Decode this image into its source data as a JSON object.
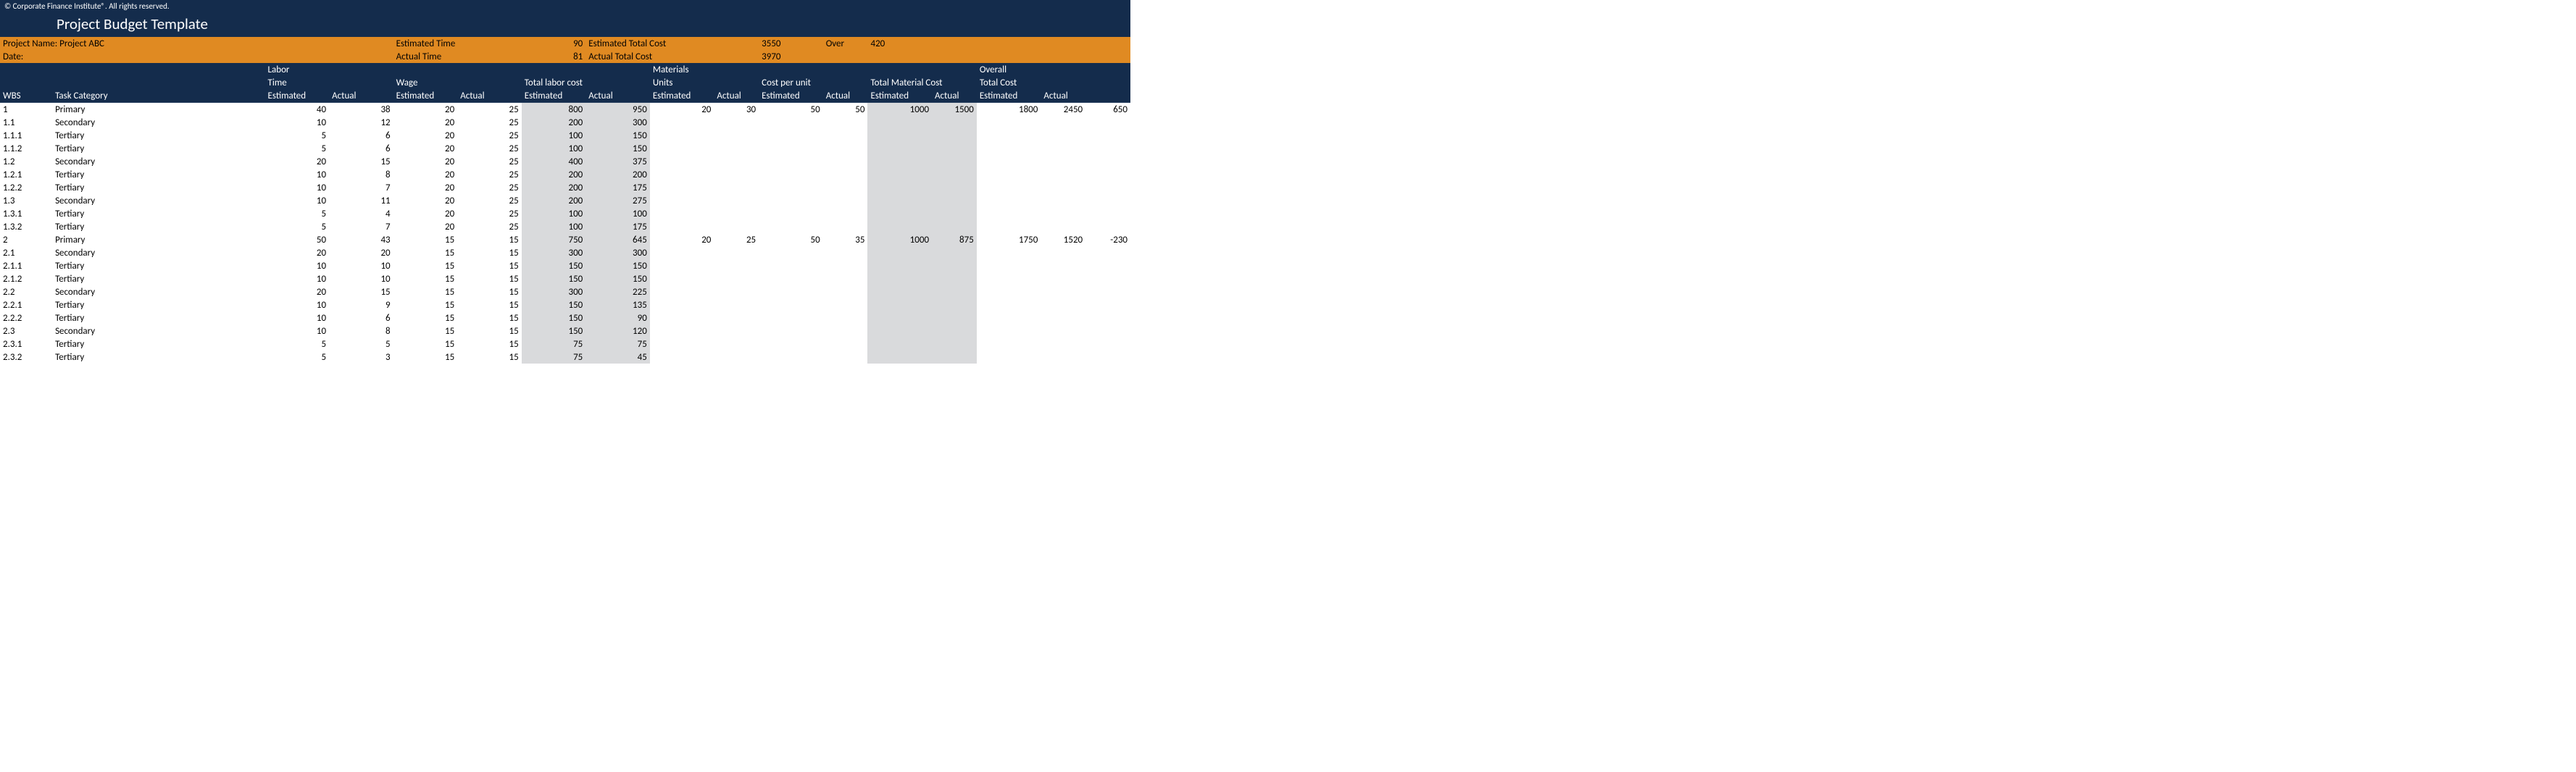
{
  "copyright": "© Corporate Finance Institute®. All rights reserved.",
  "title": "Project Budget Template",
  "summary": {
    "project_name_label": "Project Name: Project ABC",
    "date_label": "Date:",
    "est_time_label": "Estimated Time",
    "est_time": "90",
    "est_total_cost_label": "Estimated Total Cost",
    "est_total_cost": "3550",
    "over_label": "Over",
    "over": "420",
    "act_time_label": "Actual Time",
    "act_time": "81",
    "act_total_cost_label": "Actual Total Cost",
    "act_total_cost": "3970"
  },
  "hdr": {
    "wbs": "WBS",
    "task": "Task Category",
    "labor": "Labor",
    "time": "Time",
    "wage": "Wage",
    "tlc": "Total labor cost",
    "materials": "Materials",
    "units": "Units",
    "cpu": "Cost per unit",
    "tmc": "Total Material Cost",
    "overall": "Overall",
    "tc": "Total Cost",
    "est": "Estimated",
    "act": "Actual"
  },
  "rows": [
    {
      "wbs": "1",
      "task": "Primary",
      "te": "40",
      "ta": "38",
      "we": "20",
      "wa": "25",
      "lce": "800",
      "lca": "950",
      "ue": "20",
      "ua": "30",
      "cpe": "50",
      "cpa": "50",
      "mce": "1000",
      "mca": "1500",
      "tce": "1800",
      "tca": "2450",
      "var": "650"
    },
    {
      "wbs": "1.1",
      "task": "Secondary",
      "te": "10",
      "ta": "12",
      "we": "20",
      "wa": "25",
      "lce": "200",
      "lca": "300"
    },
    {
      "wbs": "1.1.1",
      "task": "Tertiary",
      "te": "5",
      "ta": "6",
      "we": "20",
      "wa": "25",
      "lce": "100",
      "lca": "150"
    },
    {
      "wbs": "1.1.2",
      "task": "Tertiary",
      "te": "5",
      "ta": "6",
      "we": "20",
      "wa": "25",
      "lce": "100",
      "lca": "150"
    },
    {
      "wbs": "1.2",
      "task": "Secondary",
      "te": "20",
      "ta": "15",
      "we": "20",
      "wa": "25",
      "lce": "400",
      "lca": "375"
    },
    {
      "wbs": "1.2.1",
      "task": "Tertiary",
      "te": "10",
      "ta": "8",
      "we": "20",
      "wa": "25",
      "lce": "200",
      "lca": "200"
    },
    {
      "wbs": "1.2.2",
      "task": "Tertiary",
      "te": "10",
      "ta": "7",
      "we": "20",
      "wa": "25",
      "lce": "200",
      "lca": "175"
    },
    {
      "wbs": "1.3",
      "task": "Secondary",
      "te": "10",
      "ta": "11",
      "we": "20",
      "wa": "25",
      "lce": "200",
      "lca": "275"
    },
    {
      "wbs": "1.3.1",
      "task": "Tertiary",
      "te": "5",
      "ta": "4",
      "we": "20",
      "wa": "25",
      "lce": "100",
      "lca": "100"
    },
    {
      "wbs": "1.3.2",
      "task": "Tertiary",
      "te": "5",
      "ta": "7",
      "we": "20",
      "wa": "25",
      "lce": "100",
      "lca": "175"
    },
    {
      "wbs": "2",
      "task": "Primary",
      "te": "50",
      "ta": "43",
      "we": "15",
      "wa": "15",
      "lce": "750",
      "lca": "645",
      "ue": "20",
      "ua": "25",
      "cpe": "50",
      "cpa": "35",
      "mce": "1000",
      "mca": "875",
      "tce": "1750",
      "tca": "1520",
      "var": "-230"
    },
    {
      "wbs": "2.1",
      "task": "Secondary",
      "te": "20",
      "ta": "20",
      "we": "15",
      "wa": "15",
      "lce": "300",
      "lca": "300"
    },
    {
      "wbs": "2.1.1",
      "task": "Tertiary",
      "te": "10",
      "ta": "10",
      "we": "15",
      "wa": "15",
      "lce": "150",
      "lca": "150"
    },
    {
      "wbs": "2.1.2",
      "task": "Tertiary",
      "te": "10",
      "ta": "10",
      "we": "15",
      "wa": "15",
      "lce": "150",
      "lca": "150"
    },
    {
      "wbs": "2.2",
      "task": "Secondary",
      "te": "20",
      "ta": "15",
      "we": "15",
      "wa": "15",
      "lce": "300",
      "lca": "225"
    },
    {
      "wbs": "2.2.1",
      "task": "Tertiary",
      "te": "10",
      "ta": "9",
      "we": "15",
      "wa": "15",
      "lce": "150",
      "lca": "135"
    },
    {
      "wbs": "2.2.2",
      "task": "Tertiary",
      "te": "10",
      "ta": "6",
      "we": "15",
      "wa": "15",
      "lce": "150",
      "lca": "90"
    },
    {
      "wbs": "2.3",
      "task": "Secondary",
      "te": "10",
      "ta": "8",
      "we": "15",
      "wa": "15",
      "lce": "150",
      "lca": "120"
    },
    {
      "wbs": "2.3.1",
      "task": "Tertiary",
      "te": "5",
      "ta": "5",
      "we": "15",
      "wa": "15",
      "lce": "75",
      "lca": "75"
    },
    {
      "wbs": "2.3.2",
      "task": "Tertiary",
      "te": "5",
      "ta": "3",
      "we": "15",
      "wa": "15",
      "lce": "75",
      "lca": "45"
    }
  ]
}
